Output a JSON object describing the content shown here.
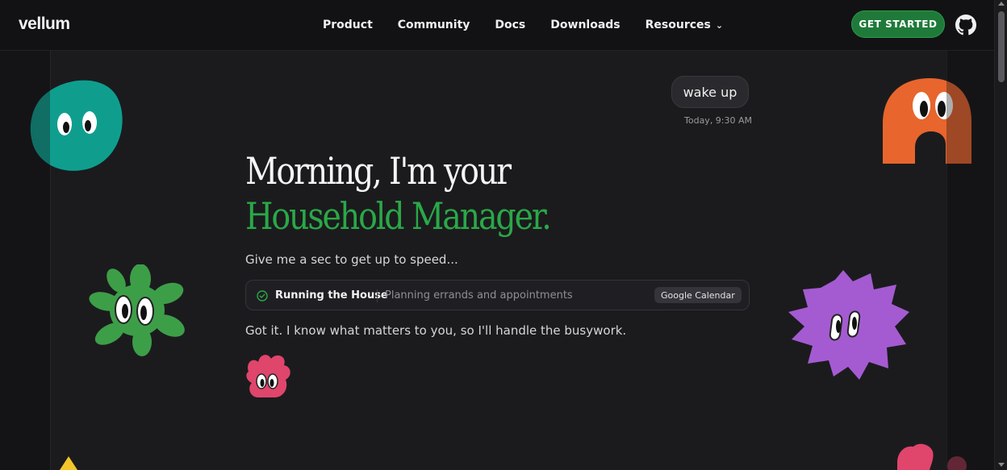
{
  "nav": {
    "logo": "vellum",
    "links": [
      "Product",
      "Community",
      "Docs",
      "Downloads",
      "Resources"
    ],
    "cta_label": "GET STARTED"
  },
  "chat": {
    "user_message": "wake up",
    "timestamp": "Today, 9:30 AM"
  },
  "hero": {
    "headline_line1": "Morning, I'm your",
    "headline_line2": "Household Manager.",
    "subtitle": "Give me a sec to get up to speed...",
    "reply": "Got it. I know what matters to you, so I'll handle the busywork."
  },
  "task": {
    "title": "Running the House",
    "description": "Planning errands and appointments",
    "badge": "Google Calendar",
    "status_icon": "check-circle-icon"
  },
  "colors": {
    "accent_green": "#2aa847",
    "cta_green": "#1f7a3a",
    "teal": "#0f9e8e",
    "orange": "#e8652d",
    "leaf_green": "#3d9e48",
    "purple": "#a45bd1",
    "pink": "#e0456b"
  }
}
